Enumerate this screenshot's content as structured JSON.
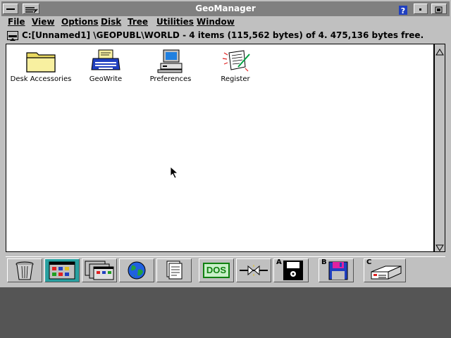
{
  "window": {
    "title": "GeoManager"
  },
  "menubar": {
    "items": [
      {
        "label": "File"
      },
      {
        "label": "View"
      },
      {
        "label": "Options"
      },
      {
        "label": "Disk"
      },
      {
        "label": "Tree"
      },
      {
        "label": "Utilities"
      },
      {
        "label": "Window"
      }
    ]
  },
  "pathbar": {
    "text": "C:[Unnamed1] \\GEOPUBL\\WORLD - 4 items (115,562 bytes) of 4. 475,136 bytes free."
  },
  "folder": {
    "items": [
      {
        "label": "Desk Accessories",
        "icon": "folder-icon"
      },
      {
        "label": "GeoWrite",
        "icon": "typewriter-icon"
      },
      {
        "label": "Preferences",
        "icon": "computer-icon"
      },
      {
        "label": "Register",
        "icon": "document-icon"
      }
    ]
  },
  "toolbar": {
    "buttons": [
      {
        "name": "wastebasket-icon"
      },
      {
        "name": "overlapping-windows-icon",
        "active": true
      },
      {
        "name": "full-screen-windows-icon"
      },
      {
        "name": "globe-icon"
      },
      {
        "name": "documents-icon"
      },
      {
        "name": "dos-icon",
        "label": "DOS"
      },
      {
        "name": "exit-arrows-icon"
      },
      {
        "name": "floppy-drive-a-icon",
        "drive": "A"
      },
      {
        "name": "floppy-disk-b-icon",
        "drive": "B"
      },
      {
        "name": "hard-drive-c-icon",
        "drive": "C"
      }
    ]
  },
  "colors": {
    "title_bg": "#808080",
    "pane_bg": "#ffffff",
    "chrome": "#c0c0c0",
    "active_tool": "#28a0a0",
    "desktop": "#555555"
  }
}
